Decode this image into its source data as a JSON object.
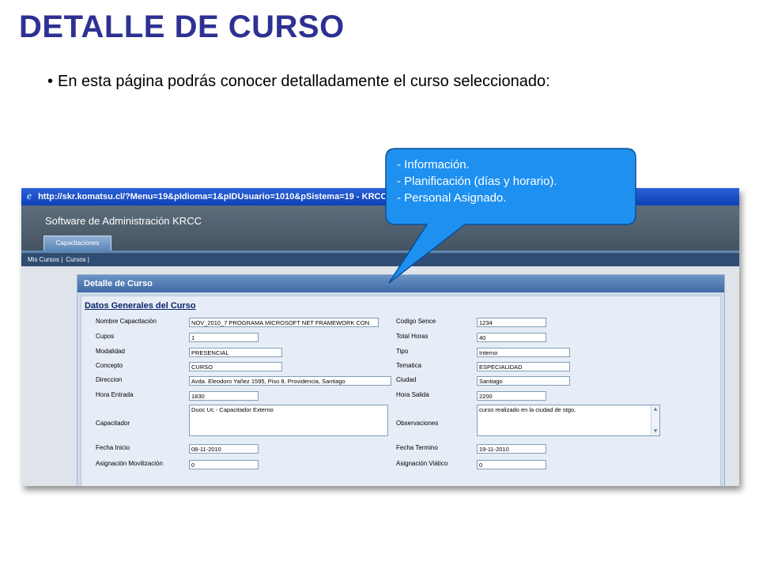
{
  "slide": {
    "title": "DETALLE DE CURSO",
    "bullet": "En esta página podrás conocer detalladamente el curso seleccionado:"
  },
  "callout": {
    "lines": [
      "- Información.",
      "- Planificación (días y horario).",
      "- Personal Asignado."
    ],
    "color": "#1e90f0"
  },
  "window": {
    "title": "http://skr.komatsu.cl/?Menu=19&pIdioma=1&pIDUsuario=1010&pSistema=19 - KRCC - Windows Internet Explorer",
    "app_title": "Software de Administración KRCC",
    "tab": "Capacitaciones",
    "nav": [
      "Mis Cursos |",
      "Cursos |"
    ]
  },
  "panel": {
    "header": "Detalle de Curso",
    "section": "Datos Generales del Curso",
    "fields": {
      "nombre_label": "Nombre Capacitación",
      "nombre_value": "NOV_2010_7 PROGRAMA MICROSOFT NET FRAMEWORK CON",
      "codigo_label": "Codigo Sence",
      "codigo_value": "1234",
      "cupos_label": "Cupos",
      "cupos_value": "1",
      "horas_label": "Total Horas",
      "horas_value": "40",
      "modalidad_label": "Modalidad",
      "modalidad_value": "PRESENCIAL",
      "tipo_label": "Tipo",
      "tipo_value": "Interno",
      "concepto_label": "Concepto",
      "concepto_value": "CURSO",
      "tematica_label": "Tematica",
      "tematica_value": "ESPECIALIDAD",
      "direccion_label": "Direccion",
      "direccion_value": "Avda. Eleodoro Yañez 1595, Piso 8, Providencia, Santiago",
      "ciudad_label": "Ciudad",
      "ciudad_value": "Santiago",
      "hora_entrada_label": "Hora Entrada",
      "hora_entrada_value": "1830",
      "hora_salida_label": "Hora Salida",
      "hora_salida_value": "2200",
      "capacitador_label": "Capacitador",
      "capacitador_value": "Duoc Uc - Capacitador Externo",
      "observaciones_label": "Observaciones",
      "observaciones_value": "curso realizado en la ciudad de stgo.",
      "fecha_inicio_label": "Fecha Inicio",
      "fecha_inicio_value": "08-11-2010",
      "fecha_termino_label": "Fecha Termino",
      "fecha_termino_value": "19-11-2010",
      "movilizacion_label": "Asignación Movilización",
      "movilizacion_value": "0",
      "viatico_label": "Asignación Viático",
      "viatico_value": "0"
    }
  }
}
